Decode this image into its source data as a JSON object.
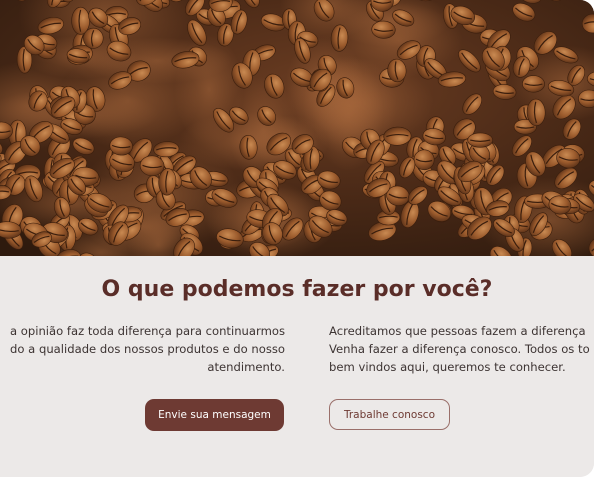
{
  "hero": {
    "image_subject": "coffee-beans-photo"
  },
  "section": {
    "title": "O que podemos fazer por você?"
  },
  "left_column": {
    "lines": [
      "a opinião faz toda diferença para continuarmos",
      "do a qualidade dos nossos produtos e do nosso",
      "atendimento."
    ],
    "button_label": "Envie sua mensagem"
  },
  "right_column": {
    "lines": [
      "Acreditamos que pessoas fazem a diferença",
      "Venha fazer a diferença conosco. Todos os to",
      "bem vindos aqui, queremos te conhecer."
    ],
    "button_label": "Trabalhe conosco"
  },
  "colors": {
    "title": "#5a2d28",
    "primary_button": "#6e3a33",
    "background": "#ece9e8",
    "text": "#3d3433"
  }
}
